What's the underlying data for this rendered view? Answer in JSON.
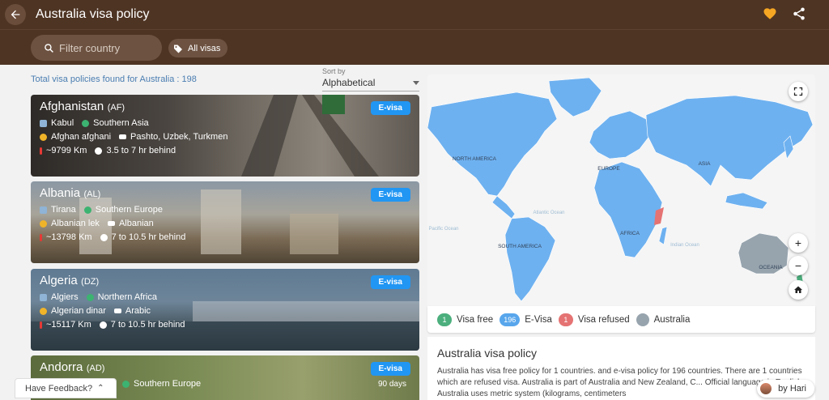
{
  "header": {
    "title": "Australia visa policy"
  },
  "search": {
    "placeholder": "Filter country"
  },
  "filter_chip": {
    "label": "All visas"
  },
  "summary": {
    "text": "Total visa policies found for  Australia : 198"
  },
  "sort": {
    "label": "Sort by",
    "value": "Alphabetical"
  },
  "countries": [
    {
      "name": "Afghanistan",
      "code": "(AF)",
      "capital": "Kabul",
      "region": "Southern Asia",
      "currency": "Afghan afghani",
      "languages": "Pashto, Uzbek, Turkmen",
      "distance": "~9799 Km",
      "time": "3.5 to 7 hr behind",
      "visa": "E-visa"
    },
    {
      "name": "Albania",
      "code": "(AL)",
      "capital": "Tirana",
      "region": "Southern Europe",
      "currency": "Albanian lek",
      "languages": "Albanian",
      "distance": "~13798 Km",
      "time": "7 to 10.5 hr behind",
      "visa": "E-visa"
    },
    {
      "name": "Algeria",
      "code": "(DZ)",
      "capital": "Algiers",
      "region": "Northern Africa",
      "currency": "Algerian dinar",
      "languages": "Arabic",
      "distance": "~15117 Km",
      "time": "7 to 10.5 hr behind",
      "visa": "E-visa"
    },
    {
      "name": "Andorra",
      "code": "(AD)",
      "region": "Southern Europe",
      "visa": "E-visa",
      "days": "90 days"
    }
  ],
  "map": {
    "labels": [
      "NORTH AMERICA",
      "EUROPE",
      "ASIA",
      "AFRICA",
      "SOUTH AMERICA",
      "OCEANIA",
      "Atlantic Ocean",
      "Pacific Ocean",
      "Indian Ocean"
    ]
  },
  "legend": {
    "visa_free": {
      "count": "1",
      "label": "Visa free",
      "color": "#4caf7d"
    },
    "evisa": {
      "count": "196",
      "label": "E-Visa",
      "color": "#58a6ec"
    },
    "refused": {
      "count": "1",
      "label": "Visa refused",
      "color": "#e57373"
    },
    "home": {
      "label": "Australia",
      "color": "#97a4ae"
    }
  },
  "policy": {
    "title": "Australia visa policy",
    "body": "Australia has visa free policy for 1 countries. and e-visa policy for 196 countries. There are 1 countries which are refused visa. Australia is part of Australia and New Zealand, C... Official language is English. Australia uses metric system (kilograms, centimeters"
  },
  "feedback": {
    "label": "Have Feedback?"
  },
  "author": {
    "label": "by Hari"
  },
  "colors": {
    "header": "#4e3423",
    "accent": "#2196f3",
    "favorite": "#f5a623",
    "map_land": "#6eb1f0"
  }
}
